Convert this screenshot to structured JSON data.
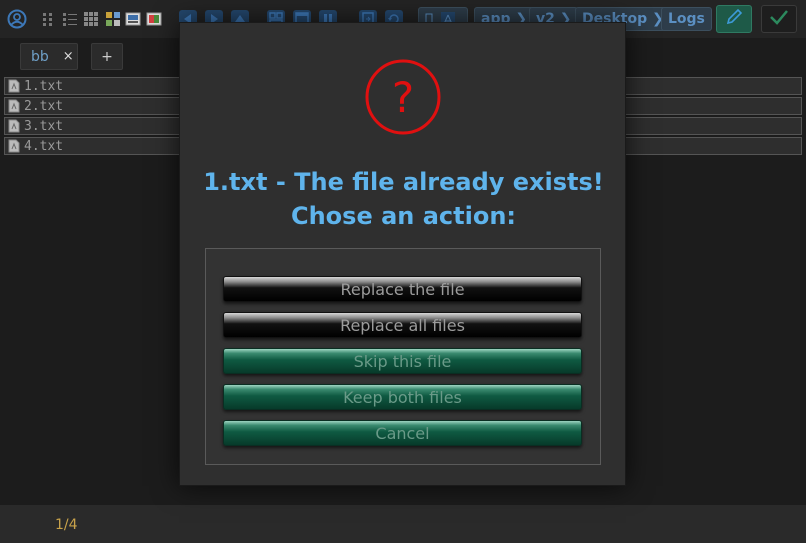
{
  "toolbar": {
    "icons": [
      "profile-icon",
      "view-columns-icon",
      "view-list-icon",
      "view-grid-icon",
      "view-thumbnails-icon",
      "image-icon",
      "image-color-icon",
      "back-icon",
      "forward-icon",
      "up-icon",
      "window-multi-icon",
      "window-icon",
      "pause-icon",
      "doc-arrow-icon",
      "refresh-icon"
    ],
    "breadcrumbs": [
      "app",
      "v2",
      "Desktop",
      "Logs"
    ],
    "colors": {
      "accent": "#5b8fc2",
      "edit_button": "#1e5a48",
      "ok_button": "#1e1e1e"
    }
  },
  "tabs": [
    {
      "label": "bb",
      "close": "×"
    },
    {
      "label": "+"
    }
  ],
  "files": [
    "1.txt",
    "2.txt",
    "3.txt",
    "4.txt"
  ],
  "dialog": {
    "title_line1": "1.txt - The file already exists!",
    "title_line2": "Chose an action:",
    "icon": "question-icon",
    "icon_color": "#e01010",
    "actions": [
      "Replace the file",
      "Replace all files",
      "Skip this file",
      "Keep both files",
      "Cancel"
    ]
  },
  "status": {
    "page": "1/4"
  }
}
